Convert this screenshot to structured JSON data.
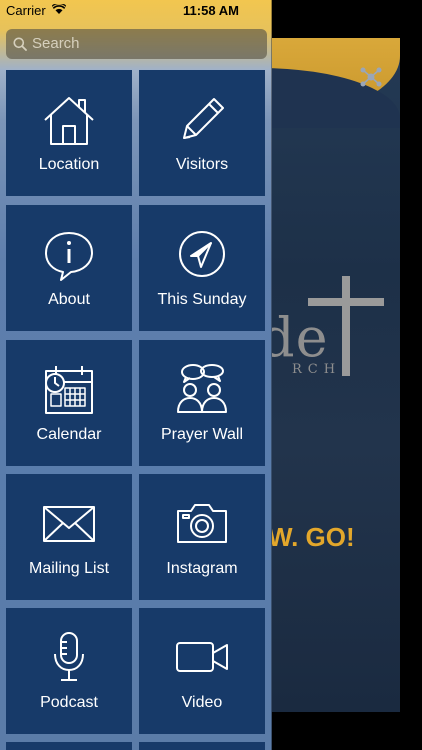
{
  "status_bar": {
    "carrier": "Carrier",
    "time": "11:58 AM"
  },
  "search": {
    "placeholder": "Search"
  },
  "menu": {
    "items": [
      {
        "label": "Location",
        "icon": "house-icon"
      },
      {
        "label": "Visitors",
        "icon": "pencil-icon"
      },
      {
        "label": "About",
        "icon": "info-bubble-icon"
      },
      {
        "label": "This Sunday",
        "icon": "compass-icon"
      },
      {
        "label": "Calendar",
        "icon": "calendar-icon"
      },
      {
        "label": "Prayer Wall",
        "icon": "people-chat-icon"
      },
      {
        "label": "Mailing List",
        "icon": "envelope-icon"
      },
      {
        "label": "Instagram",
        "icon": "camera-icon"
      },
      {
        "label": "Podcast",
        "icon": "microphone-icon"
      },
      {
        "label": "Video",
        "icon": "video-camera-icon"
      }
    ]
  },
  "background_app": {
    "logo_text": "de",
    "logo_subtext": "RCH",
    "tagline": "W. GO!"
  },
  "colors": {
    "tile": "#173a69",
    "accent_gold": "#e3a72b",
    "drawer_top": "#f2c64f"
  }
}
